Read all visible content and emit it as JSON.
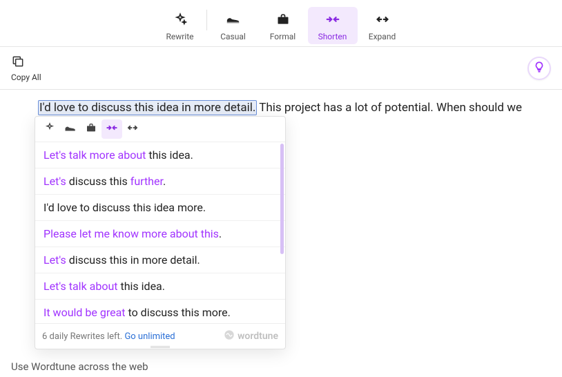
{
  "toolbar": {
    "rewrite": "Rewrite",
    "casual": "Casual",
    "formal": "Formal",
    "shorten": "Shorten",
    "expand": "Expand"
  },
  "secbar": {
    "copy_all": "Copy All"
  },
  "editor": {
    "highlighted": "I'd love to discuss this idea in more detail.",
    "rest": " This project has a lot of potential. When should we set"
  },
  "suggestions": [
    {
      "segments": [
        {
          "t": "Let's talk more about",
          "hl": true
        },
        {
          "t": " this idea.",
          "hl": false
        }
      ]
    },
    {
      "segments": [
        {
          "t": "Let's",
          "hl": true
        },
        {
          "t": " discuss this ",
          "hl": false
        },
        {
          "t": "further",
          "hl": true
        },
        {
          "t": ".",
          "hl": false
        }
      ]
    },
    {
      "segments": [
        {
          "t": "I'd love to discuss this idea more.",
          "hl": false
        }
      ]
    },
    {
      "segments": [
        {
          "t": "Please let me know more about this",
          "hl": true
        },
        {
          "t": ".",
          "hl": false
        }
      ]
    },
    {
      "segments": [
        {
          "t": "Let's",
          "hl": true
        },
        {
          "t": " discuss this in more detail.",
          "hl": false
        }
      ]
    },
    {
      "segments": [
        {
          "t": "Let's talk about",
          "hl": true
        },
        {
          "t": " this idea.",
          "hl": false
        }
      ]
    },
    {
      "segments": [
        {
          "t": "It would be great",
          "hl": true
        },
        {
          "t": " to discuss this more.",
          "hl": false
        }
      ]
    }
  ],
  "footer": {
    "tip_prefix": "6 daily Rewrites left. ",
    "tip_link": "Go unlimited",
    "brand": "wordtune"
  },
  "page_hint": "Use Wordtune across the web"
}
